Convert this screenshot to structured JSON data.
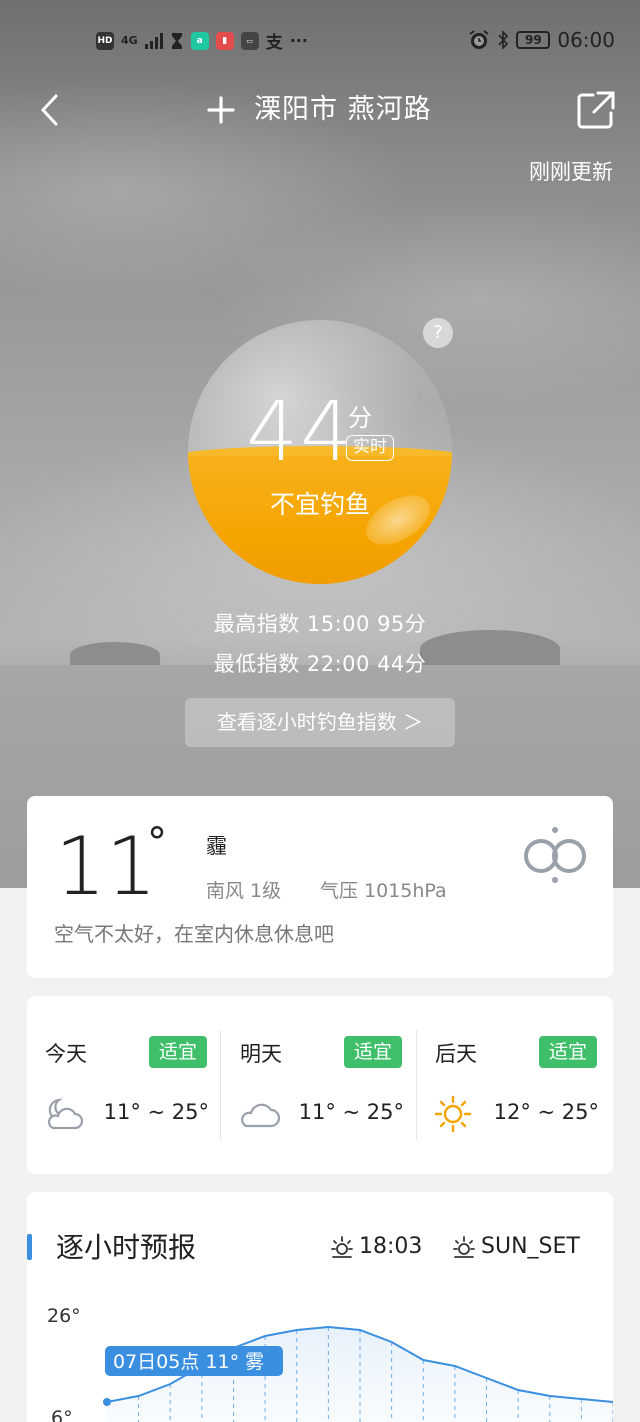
{
  "status_bar": {
    "left_labels": [
      "HD",
      "4G"
    ],
    "time": "06:00",
    "battery": "99"
  },
  "header": {
    "location": "溧阳市 燕河路",
    "updated": "刚刚更新"
  },
  "fishing_index": {
    "score": "44",
    "unit": "分",
    "tag": "实时",
    "verdict": "不宜钓鱼",
    "fill_fraction": 0.44,
    "highest": "最高指数  15:00  95分",
    "lowest": "最低指数  22:00  44分",
    "hourly_button": "查看逐小时钓鱼指数 ＞",
    "help": "?"
  },
  "current": {
    "temp": "11",
    "deg": "°",
    "condition": "霾",
    "wind": "南风  1级",
    "pressure": "气压  1015hPa",
    "tip": "空气不太好，在室内休息休息吧",
    "icon": "haze-icon"
  },
  "days": [
    {
      "name": "今天",
      "badge": "适宜",
      "range": "11° ~ 25°",
      "icon": "partly-cloudy-night-icon"
    },
    {
      "name": "明天",
      "badge": "适宜",
      "range": "11° ~ 25°",
      "icon": "cloud-icon"
    },
    {
      "name": "后天",
      "badge": "适宜",
      "range": "12° ~ 25°",
      "icon": "sun-icon"
    }
  ],
  "forecast": {
    "title": "逐小时预报",
    "sunrise_time": "18:03",
    "sunset_label": "SUN_SET",
    "tooltip": "07日05点 11° 雾",
    "accent": "#3b8fe0"
  },
  "chart_data": {
    "type": "line",
    "ytick_top": "26°",
    "ytick_bottom": "6°",
    "values": [
      11,
      12,
      14,
      17,
      20,
      22,
      23,
      23.5,
      23,
      21,
      18,
      17,
      15,
      13,
      12,
      11.5,
      11
    ],
    "ylim": [
      6,
      26
    ]
  }
}
